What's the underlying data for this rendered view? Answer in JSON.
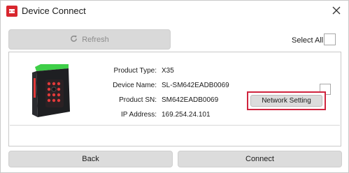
{
  "window": {
    "title": "Device Connect"
  },
  "toolbar": {
    "refresh_label": "Refresh",
    "select_all_label": "Select All"
  },
  "device": {
    "fields": [
      {
        "label": "Product Type:",
        "value": "X35"
      },
      {
        "label": "Device Name:",
        "value": "SL-SM642EADB0069"
      },
      {
        "label": "Product SN:",
        "value": "SM642EADB0069"
      },
      {
        "label": "IP Address:",
        "value": "169.254.24.101"
      }
    ],
    "network_setting_label": "Network Setting"
  },
  "footer": {
    "back_label": "Back",
    "connect_label": "Connect"
  },
  "colors": {
    "accent_red": "#d0253f",
    "button_gray": "#dcdcdc",
    "led_green": "#3ecf48",
    "led_red": "#e23a3a"
  },
  "icons": {
    "app": "app-logo-icon",
    "close": "close-icon",
    "refresh": "refresh-icon",
    "device": "scanner-device-icon"
  }
}
